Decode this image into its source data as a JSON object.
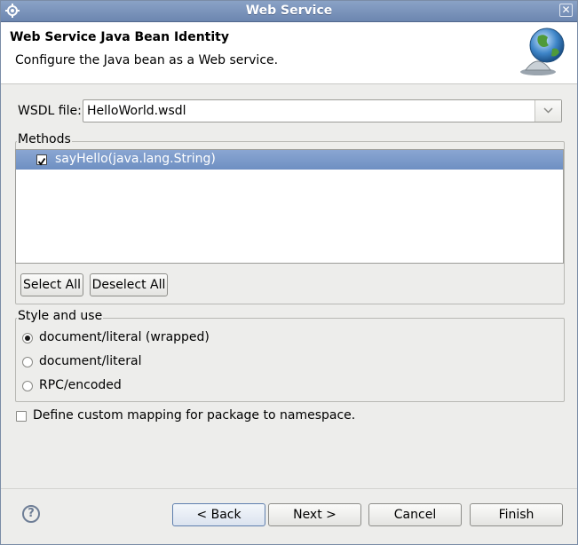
{
  "window": {
    "title": "Web Service",
    "close_glyph": "✕"
  },
  "header": {
    "title": "Web Service Java Bean Identity",
    "description": "Configure the Java bean as a Web service.",
    "icon": "globe-icon"
  },
  "wsdl": {
    "label": "WSDL file:",
    "value": "HelloWorld.wsdl"
  },
  "methods": {
    "legend": "Methods",
    "items": [
      {
        "label": "sayHello(java.lang.String)",
        "checked": true,
        "selected": true
      }
    ],
    "select_all_label": "Select All",
    "deselect_all_label": "Deselect All"
  },
  "style_use": {
    "legend": "Style and use",
    "options": [
      {
        "label": "document/literal (wrapped)",
        "selected": true
      },
      {
        "label": "document/literal",
        "selected": false
      },
      {
        "label": "RPC/encoded",
        "selected": false
      }
    ]
  },
  "custom_mapping": {
    "label": "Define custom mapping for package to namespace.",
    "checked": false
  },
  "footer": {
    "help_glyph": "?",
    "back_label": "< Back",
    "next_label": "Next >",
    "cancel_label": "Cancel",
    "finish_label": "Finish"
  },
  "colors": {
    "titlebar": "#7890b8",
    "selection": "#7a98c8"
  }
}
